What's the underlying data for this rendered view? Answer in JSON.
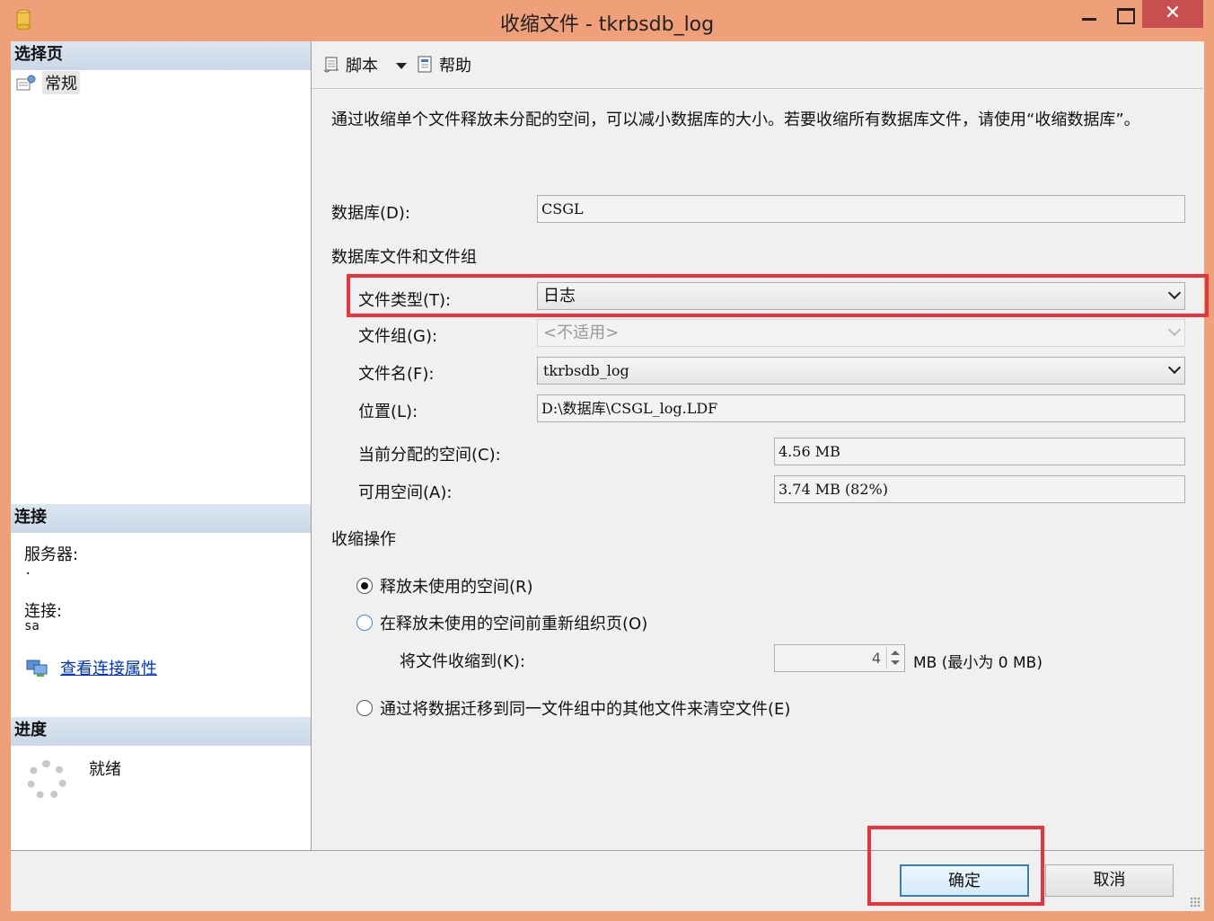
{
  "window": {
    "title": "收缩文件 - tkrbsdb_log",
    "close_label": "✕"
  },
  "left": {
    "select_page_header": "选择页",
    "pages": [
      {
        "label": "常规",
        "icon": "page-settings-icon"
      }
    ],
    "connection_header": "连接",
    "server_label": "服务器:",
    "server_value": ".",
    "connection_label": "连接:",
    "connection_value": "sa",
    "view_props_link": "查看连接属性",
    "progress_header": "进度",
    "progress_status": "就绪"
  },
  "toolbar": {
    "script_label": "脚本",
    "help_label": "帮助"
  },
  "form": {
    "description": "通过收缩单个文件释放未分配的空间，可以减小数据库的大小。若要收缩所有数据库文件，请使用“收缩数据库”。",
    "database_label": "数据库(D):",
    "database_value": "CSGL",
    "files_group_label": "数据库文件和文件组",
    "file_type_label": "文件类型(T):",
    "file_type_value": "日志",
    "filegroup_label": "文件组(G):",
    "filegroup_value": "<不适用>",
    "filename_label": "文件名(F):",
    "filename_value": "tkrbsdb_log",
    "location_label": "位置(L):",
    "location_value": "D:\\数据库\\CSGL_log.LDF",
    "allocated_label": "当前分配的空间(C):",
    "allocated_value": "4.56 MB",
    "available_label": "可用空间(A):",
    "available_value": "3.74 MB (82%)",
    "shrink_action_label": "收缩操作",
    "option_release_label": "释放未使用的空间(R)",
    "option_reorganize_label": "在释放未使用的空间前重新组织页(O)",
    "shrink_to_label": "将文件收缩到(K):",
    "shrink_to_value": "4",
    "shrink_to_unit": "MB (最小为 0 MB)",
    "option_empty_label": "通过将数据迁移到同一文件组中的其他文件来清空文件(E)"
  },
  "buttons": {
    "ok_label": "确定",
    "cancel_label": "取消"
  },
  "colors": {
    "window_frame": "#F0A079",
    "highlight": "#E8343A",
    "link": "#0033CC"
  }
}
